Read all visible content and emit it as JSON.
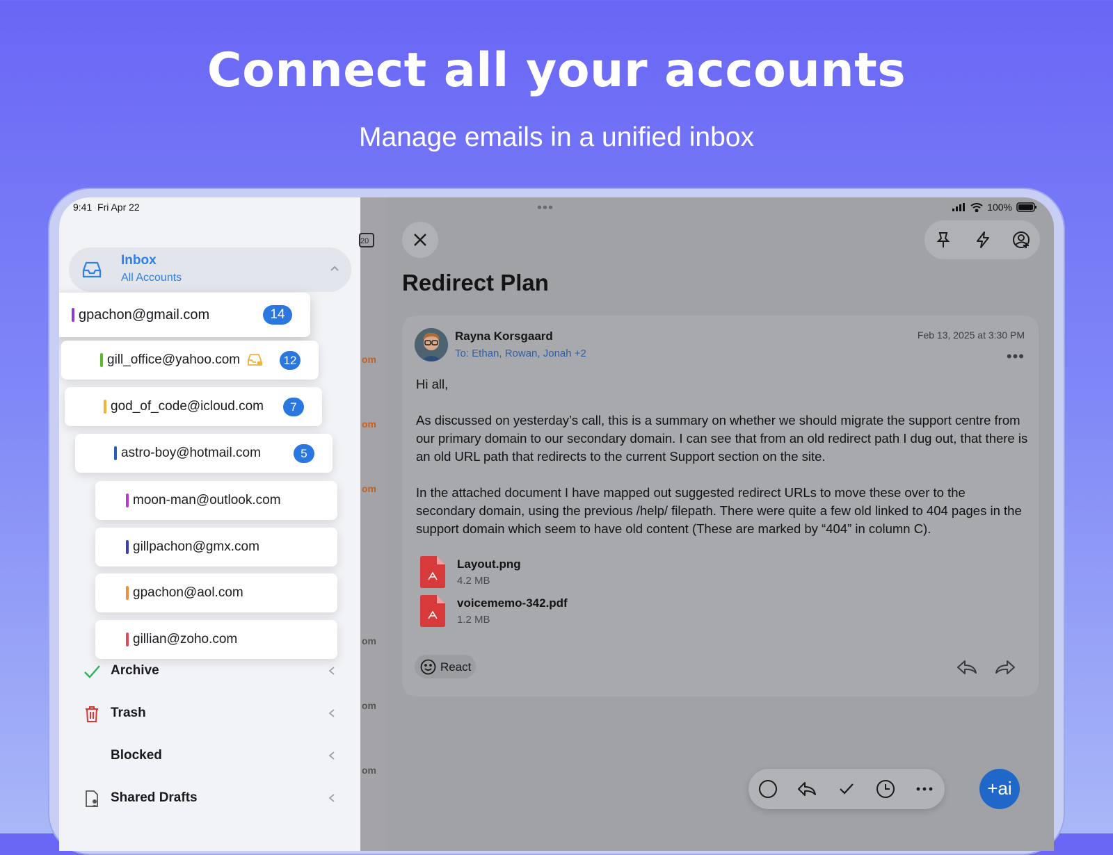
{
  "hero": {
    "title": "Connect all your accounts",
    "subtitle": "Manage emails in a unified inbox"
  },
  "status_bar": {
    "time": "9:41",
    "date": "Fri Apr 22",
    "battery": "100%"
  },
  "sidebar": {
    "inbox": {
      "label": "Inbox",
      "sublabel": "All Accounts"
    },
    "accounts": [
      {
        "email": "gpachon@gmail.com",
        "color": "#8e3ad8",
        "unread": "14"
      },
      {
        "email": "gill_office@yahoo.com",
        "color": "#5cb830",
        "unread": "12",
        "icon": "inbox-lock-icon"
      },
      {
        "email": "god_of_code@icloud.com",
        "color": "#f0b43a",
        "unread": "7"
      },
      {
        "email": "astro-boy@hotmail.com",
        "color": "#2a5fb8",
        "unread": "5"
      },
      {
        "email": "moon-man@outlook.com",
        "color": "#b43ad0",
        "unread": ""
      },
      {
        "email": "gillpachon@gmx.com",
        "color": "#3a3fb8",
        "unread": ""
      },
      {
        "email": "gpachon@aol.com",
        "color": "#f0903a",
        "unread": ""
      },
      {
        "email": "gillian@zoho.com",
        "color": "#e04a5a",
        "unread": ""
      }
    ],
    "folders": [
      {
        "label": "Archive",
        "icon": "check-icon"
      },
      {
        "label": "Trash",
        "icon": "trash-icon"
      },
      {
        "label": "Blocked",
        "icon": ""
      },
      {
        "label": "Shared Drafts",
        "icon": "shared-draft-icon"
      }
    ]
  },
  "midstrip": {
    "calendar_day": "20",
    "fragment": "om"
  },
  "email": {
    "subject": "Redirect Plan",
    "sender": "Rayna Korsgaard",
    "to": "To: Ethan, Rowan, Jonah +2",
    "date": "Feb 13, 2025 at 3:30 PM",
    "greeting": "Hi all,",
    "paragraph1": "As discussed on yesterday’s call, this is a summary on whether we should migrate the support centre from our primary domain to our secondary domain. I can see that from an old redirect path I dug out, that there is an old URL path that redirects to the current Support section on the site.",
    "paragraph2": "In the attached document I have mapped out suggested redirect URLs to move these over to the secondary domain, using the previous /help/ filepath. There were quite a few old linked to 404 pages in the support domain which seem to have old content (These are marked by “404” in column C).",
    "attachments": [
      {
        "name": "Layout.png",
        "size": "4.2 MB"
      },
      {
        "name": "voicememo-342.pdf",
        "size": "1.2 MB"
      }
    ],
    "react_label": "React"
  },
  "ai_button": {
    "label": "+ai"
  },
  "colors": {
    "accent": "#2b77e0",
    "trash": "#e0322f",
    "archive": "#2fae5a",
    "pdf": "#d8393a"
  }
}
